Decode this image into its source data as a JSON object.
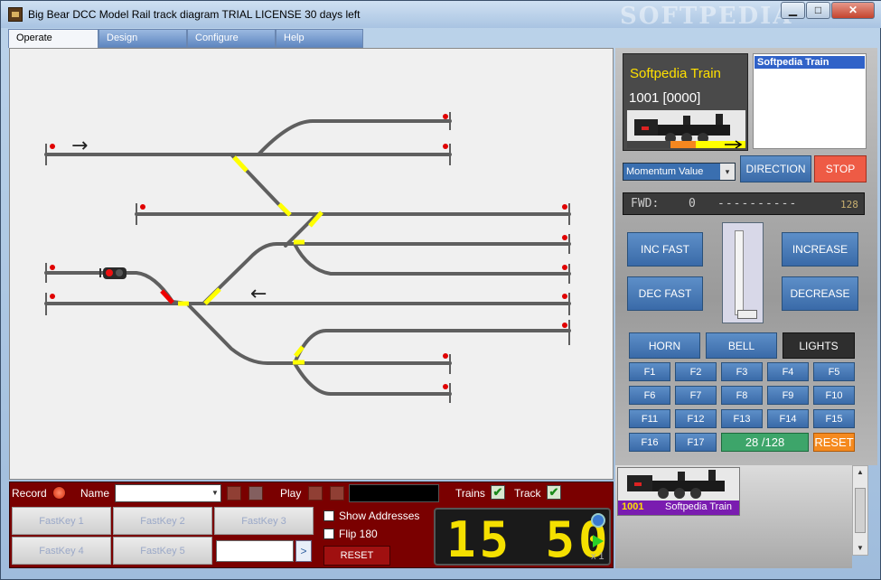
{
  "window": {
    "title": "Big Bear DCC Model Rail track diagram TRIAL LICENSE 30 days left",
    "watermark": "SOFTPEDIA",
    "minimize": "▁",
    "maximize": "□",
    "close": "✕"
  },
  "menu": [
    "Operate",
    "Design",
    "Configure",
    "Help"
  ],
  "track": {
    "arrow_right": "→",
    "arrow_left": "←",
    "colors": {
      "rail": "#5f5f5f",
      "switch_active": "#ffff00",
      "signal_red": "#ee0000",
      "endpoint": "#e00000"
    }
  },
  "loco": {
    "name": "Softpedia Train",
    "address": "1001 [0000]"
  },
  "train_list": [
    "Softpedia Train"
  ],
  "momentum": {
    "value": "Momentum Value",
    "dropdown": "▾"
  },
  "controls": {
    "direction": "DIRECTION",
    "stop": "STOP",
    "fwd_label": "FWD:",
    "fwd_value": "0",
    "fwd_bar": "----------",
    "fwd_max": "128",
    "inc_fast": "INC FAST",
    "dec_fast": "DEC FAST",
    "increase": "INCREASE",
    "decrease": "DECREASE",
    "horn": "HORN",
    "bell": "BELL",
    "lights": "LIGHTS",
    "functions": [
      "F1",
      "F2",
      "F3",
      "F4",
      "F5",
      "F6",
      "F7",
      "F8",
      "F9",
      "F10",
      "F11",
      "F12",
      "F13",
      "F14",
      "F15",
      "F16",
      "F17"
    ],
    "speed_step": "28 /128",
    "reset": "RESET"
  },
  "bottom": {
    "record": "Record",
    "name": "Name",
    "play": "Play",
    "trains": "Trains",
    "track": "Track",
    "check": "✔",
    "fastkeys": [
      "FastKey 1",
      "FastKey 2",
      "FastKey 3",
      "FastKey 4",
      "FastKey 5"
    ],
    "go": ">",
    "show_addresses": "Show Addresses",
    "flip": "Flip 180",
    "reset": "RESET",
    "clock": "15 50",
    "speed": "x 1"
  },
  "roster": {
    "number": "1001",
    "name": "Softpedia Train",
    "up": "▲",
    "down": "▼"
  }
}
